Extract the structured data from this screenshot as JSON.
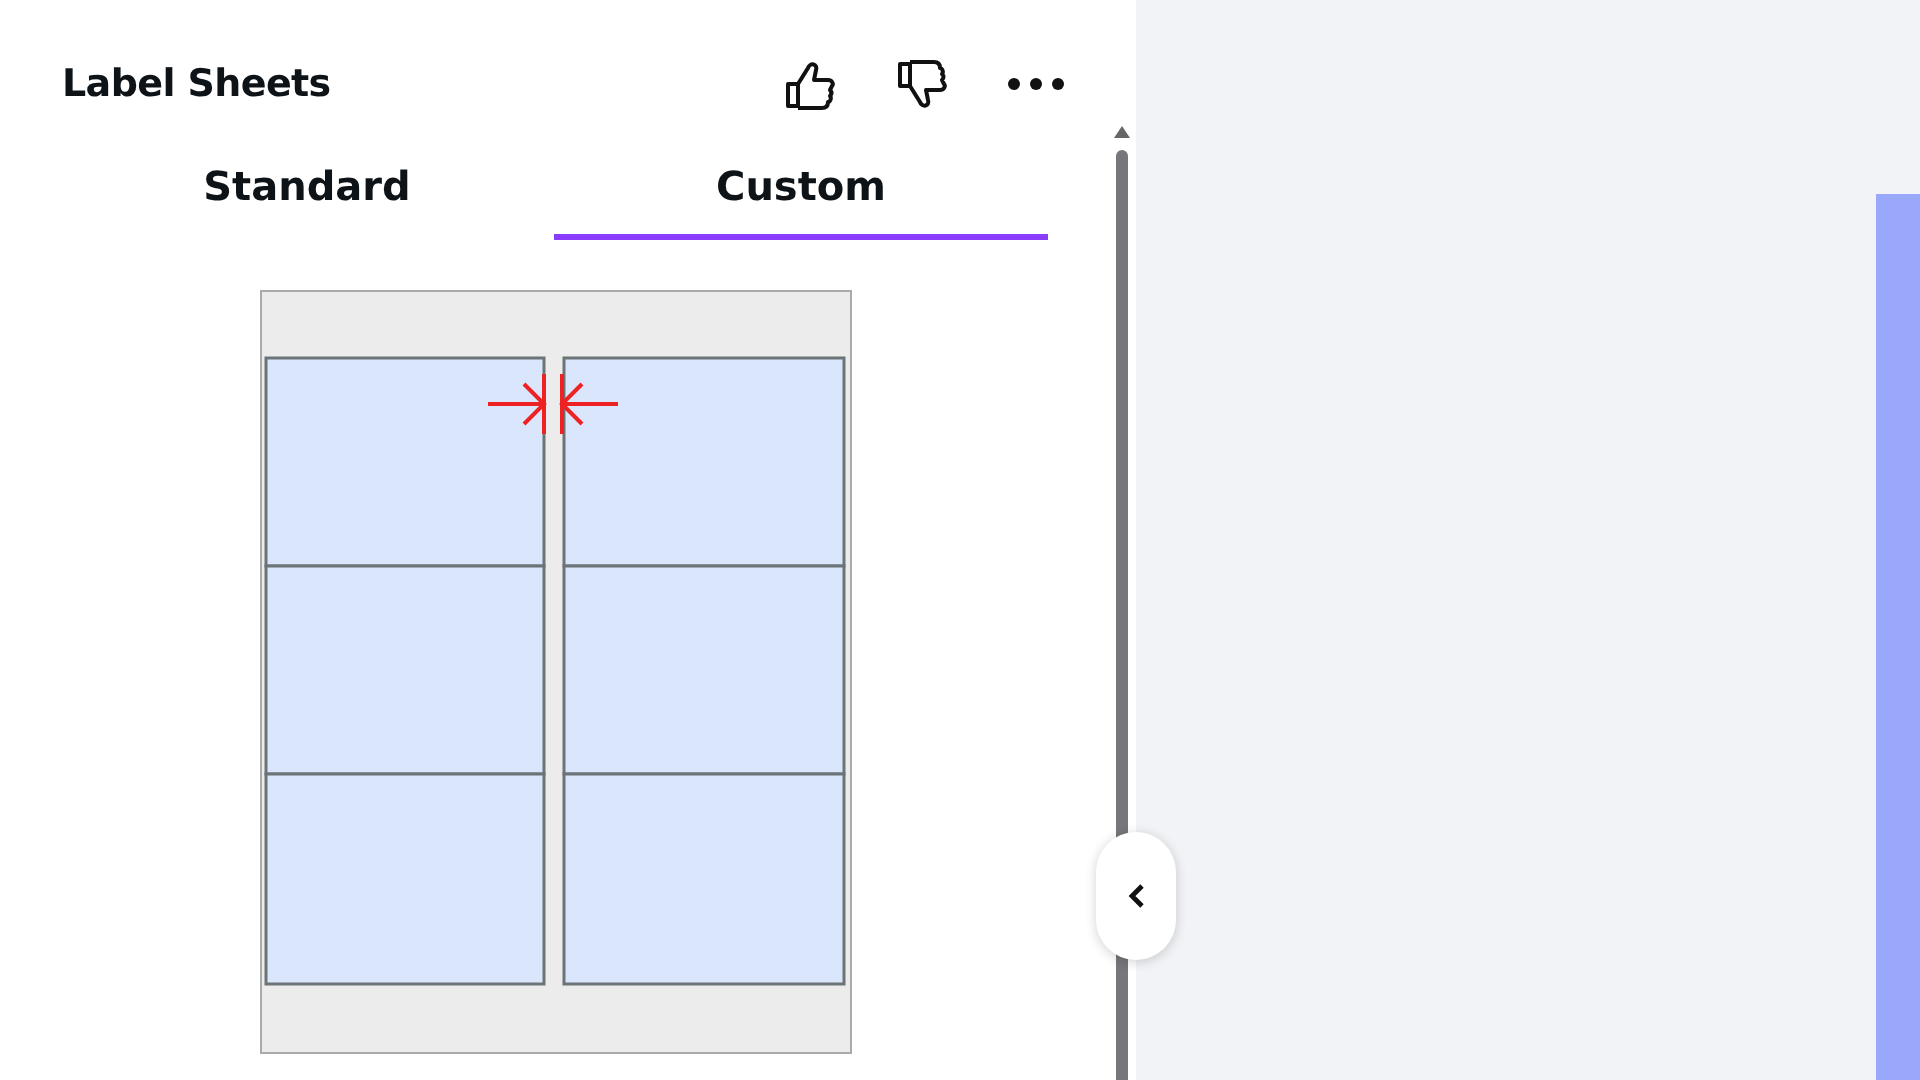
{
  "panel": {
    "title": "Label Sheets"
  },
  "tabs": [
    {
      "label": "Standard",
      "selected": false
    },
    {
      "label": "Custom",
      "selected": true
    }
  ]
}
